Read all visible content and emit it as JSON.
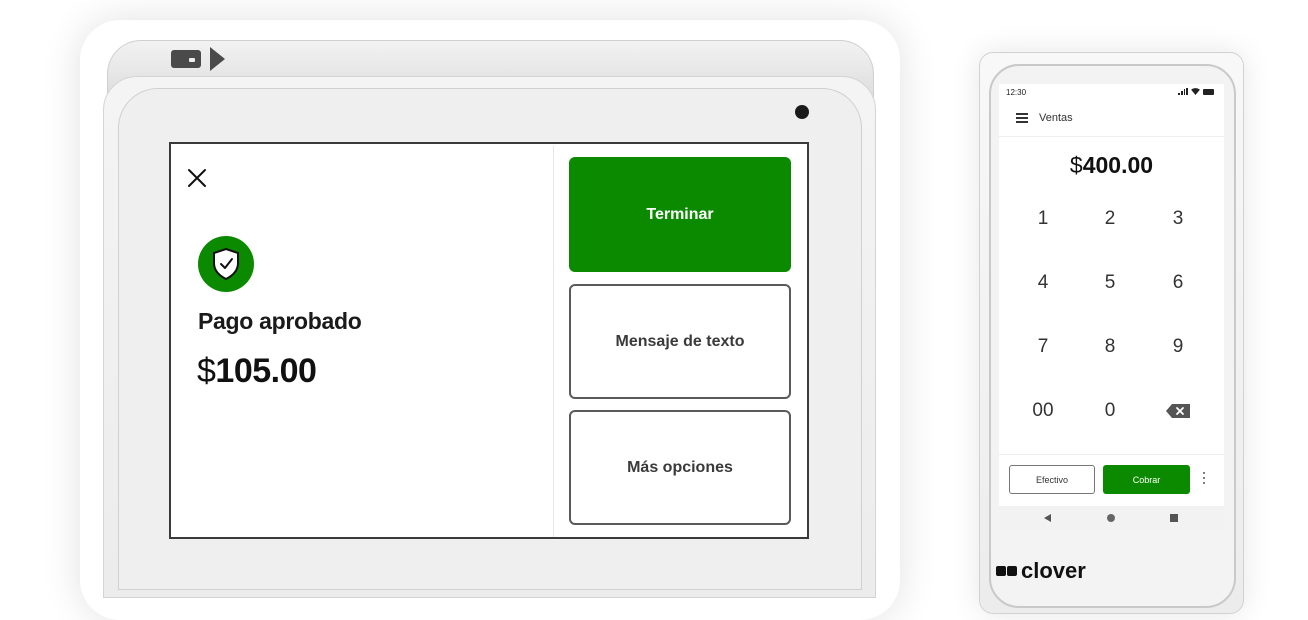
{
  "tablet": {
    "screen": {
      "title": "Pago aprobado",
      "amount_currency": "$",
      "amount_value": "105.00",
      "buttons": {
        "finish": "Terminar",
        "sms": "Mensaje de texto",
        "more": "Más opciones"
      }
    }
  },
  "phone": {
    "status": {
      "time": "12:30"
    },
    "app_title": "Ventas",
    "amount_currency": "$",
    "amount_value": "400.00",
    "keypad": [
      "1",
      "2",
      "3",
      "4",
      "5",
      "6",
      "7",
      "8",
      "9",
      "00",
      "0"
    ],
    "buttons": {
      "cash": "Efectivo",
      "charge": "Cobrar"
    }
  },
  "brand": {
    "name": "clover"
  },
  "colors": {
    "accent_green": "#0b8a00",
    "text_dark": "#111111",
    "border_gray": "#5a5a5a"
  },
  "icons": [
    "close-icon",
    "shield-check-icon",
    "menu-icon",
    "backspace-icon",
    "more-vert-icon",
    "nav-back-icon",
    "nav-home-icon",
    "nav-recent-icon"
  ]
}
